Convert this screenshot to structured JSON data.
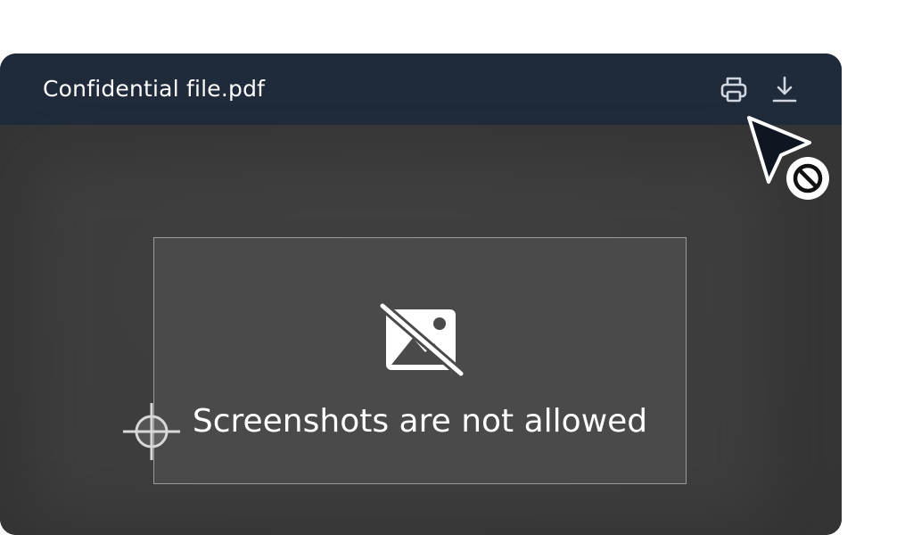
{
  "viewer": {
    "file_name": "Confidential file.pdf"
  },
  "toolbar": {
    "icons": [
      "printer-icon",
      "download-icon"
    ]
  },
  "notice": {
    "message": "Screenshots are not allowed",
    "icon": "image-off-icon"
  },
  "cursors": {
    "crosshair": "crosshair-icon",
    "pointer": "not-allowed-cursor-icon"
  },
  "colors": {
    "title_bar": "#1f2a3a",
    "content_bg": "#383838",
    "selection_bg": "#4a4a4a",
    "selection_border": "#9a9a9a",
    "text": "#ffffff"
  }
}
